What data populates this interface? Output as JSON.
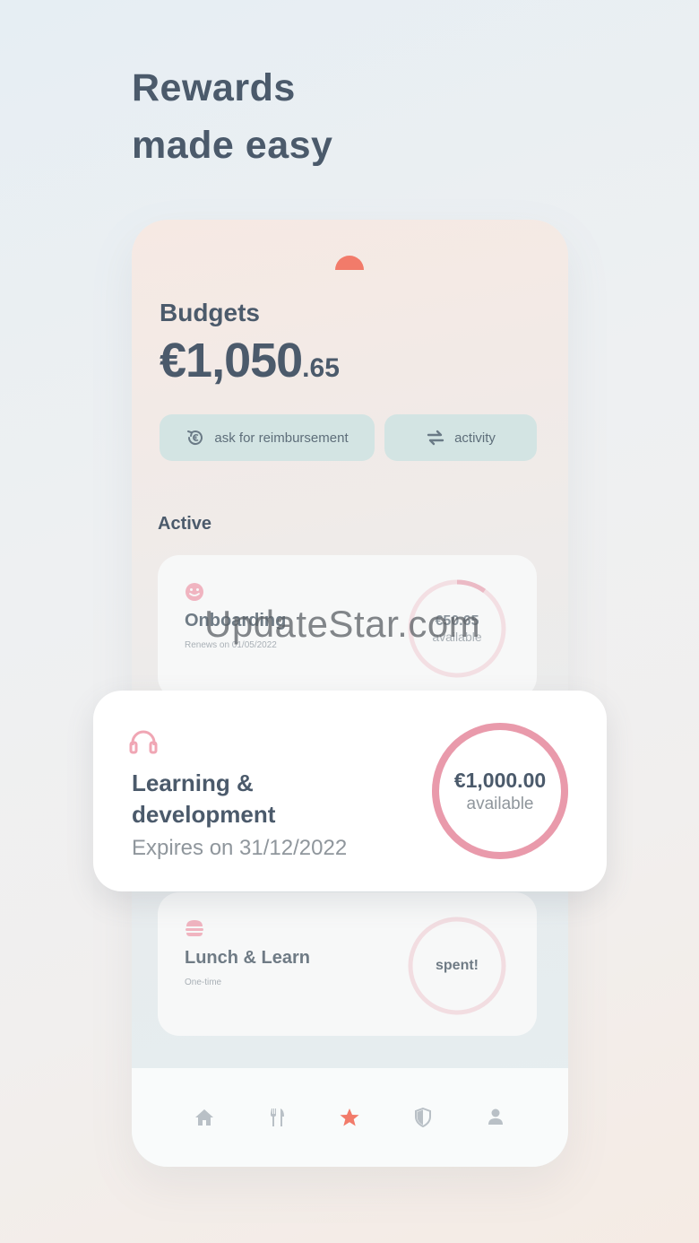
{
  "headline": {
    "line1": "Rewards",
    "line2": "made easy"
  },
  "budgets": {
    "label": "Budgets",
    "amount_main": "€1,050",
    "amount_cents": ".65"
  },
  "actions": {
    "reimbursement": "ask for reimbursement",
    "activity": "activity"
  },
  "section": {
    "active": "Active"
  },
  "cards": {
    "onboarding": {
      "title": "Onboarding",
      "subtitle": "Renews on 01/05/2022",
      "amount": "€50.65",
      "status": "available",
      "icon": "smiley-icon",
      "progress": 0.1
    },
    "learning": {
      "title": "Learning & development",
      "subtitle": "Expires on 31/12/2022",
      "amount": "€1,000.00",
      "status": "available",
      "icon": "headphones-icon",
      "progress": 1.0
    },
    "lunch": {
      "title": "Lunch & Learn",
      "subtitle": "One-time",
      "status": "spent!",
      "icon": "burger-icon"
    }
  },
  "nav": [
    "home-icon",
    "cutlery-icon",
    "star-icon",
    "shield-icon",
    "profile-icon"
  ],
  "colors": {
    "accent": "#f27b6a",
    "ring": "#e99aab",
    "pill": "#d3e4e3",
    "text": "#4b5a6b"
  },
  "watermark": "UpdateStar.com"
}
